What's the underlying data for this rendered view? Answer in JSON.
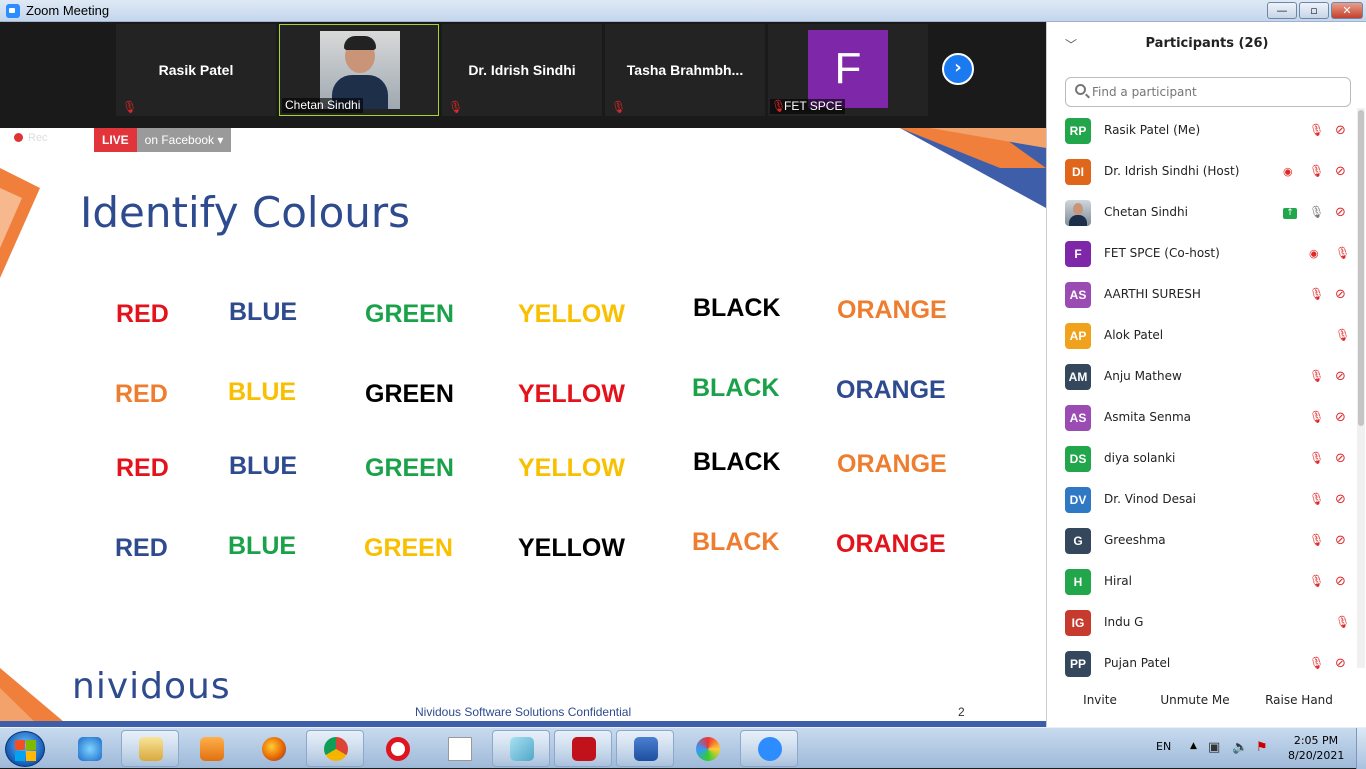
{
  "window": {
    "title": "Zoom Meeting",
    "min": "—",
    "max": "▫",
    "close": "✕"
  },
  "gallery": {
    "tiles": [
      {
        "name": "Rasik Patel"
      },
      {
        "name": "Chetan Sindhi"
      },
      {
        "name": "Dr. Idrish Sindhi"
      },
      {
        "name": "Tasha  Brahmbh..."
      },
      {
        "name": "FET SPCE",
        "avatar_letter": "F"
      }
    ],
    "next": "›"
  },
  "recording": {
    "label": "Rec",
    "live": "LIVE",
    "platform": "on Facebook",
    "dropdown": "▾"
  },
  "slide": {
    "title": "Identify Colours",
    "rows": [
      [
        {
          "t": "RED",
          "c": "#e4121b"
        },
        {
          "t": "BLUE",
          "c": "#2f4b8f"
        },
        {
          "t": "GREEN",
          "c": "#1aa24a"
        },
        {
          "t": "YELLOW",
          "c": "#f8c000"
        },
        {
          "t": "BLACK",
          "c": "#000000"
        },
        {
          "t": "ORANGE",
          "c": "#ee7d2f"
        }
      ],
      [
        {
          "t": "RED",
          "c": "#ee7d2f"
        },
        {
          "t": "BLUE",
          "c": "#f8c000"
        },
        {
          "t": "GREEN",
          "c": "#000000"
        },
        {
          "t": "YELLOW",
          "c": "#e4121b"
        },
        {
          "t": "BLACK",
          "c": "#1aa24a"
        },
        {
          "t": "ORANGE",
          "c": "#2f4b8f"
        }
      ],
      [
        {
          "t": "RED",
          "c": "#e4121b"
        },
        {
          "t": "BLUE",
          "c": "#2f4b8f"
        },
        {
          "t": "GREEN",
          "c": "#1aa24a"
        },
        {
          "t": "YELLOW",
          "c": "#f8c000"
        },
        {
          "t": "BLACK",
          "c": "#000000"
        },
        {
          "t": "ORANGE",
          "c": "#ee7d2f"
        }
      ],
      [
        {
          "t": "RED",
          "c": "#2f4b8f"
        },
        {
          "t": "BLUE",
          "c": "#1aa24a"
        },
        {
          "t": "GREEN",
          "c": "#f8c000"
        },
        {
          "t": "YELLOW",
          "c": "#000000"
        },
        {
          "t": "BLACK",
          "c": "#ee7d2f"
        },
        {
          "t": "ORANGE",
          "c": "#e4121b"
        }
      ]
    ],
    "logo": "nividous",
    "footer": "Nividous Software Solutions Confidential",
    "page": "2"
  },
  "participants": {
    "header": "Participants (26)",
    "search_placeholder": "Find a participant",
    "list": [
      {
        "initials": "RP",
        "color": "#22a64b",
        "name": "Rasik Patel (Me)",
        "icons": [
          "mic-muted",
          "video-off"
        ]
      },
      {
        "initials": "DI",
        "color": "#e0661c",
        "name": "Dr. Idrish Sindhi (Host)",
        "icons": [
          "recording",
          "mic-muted",
          "video-off"
        ]
      },
      {
        "initials": "",
        "color": "#8a9aa8",
        "name": "Chetan Sindhi",
        "icons": [
          "sharing",
          "mic-on",
          "video-off"
        ],
        "photo": true
      },
      {
        "initials": "F",
        "color": "#7e27a8",
        "name": "FET SPCE (Co-host)",
        "icons": [
          "recording",
          "mic-muted"
        ]
      },
      {
        "initials": "AS",
        "color": "#9b4cb3",
        "name": "AARTHI SURESH",
        "icons": [
          "mic-muted",
          "video-off"
        ]
      },
      {
        "initials": "AP",
        "color": "#f0a21c",
        "name": "Alok Patel",
        "icons": [
          "mic-muted"
        ]
      },
      {
        "initials": "AM",
        "color": "#35475c",
        "name": "Anju Mathew",
        "icons": [
          "mic-muted",
          "video-off"
        ]
      },
      {
        "initials": "AS",
        "color": "#9b4cb3",
        "name": "Asmita Senma",
        "icons": [
          "mic-muted",
          "video-off"
        ]
      },
      {
        "initials": "DS",
        "color": "#22a64b",
        "name": "diya solanki",
        "icons": [
          "mic-muted",
          "video-off"
        ]
      },
      {
        "initials": "DV",
        "color": "#2f78c3",
        "name": "Dr. Vinod Desai",
        "icons": [
          "mic-muted",
          "video-off"
        ]
      },
      {
        "initials": "G",
        "color": "#35475c",
        "name": "Greeshma",
        "icons": [
          "mic-muted",
          "video-off"
        ]
      },
      {
        "initials": "H",
        "color": "#22a64b",
        "name": "Hiral",
        "icons": [
          "mic-muted",
          "video-off"
        ]
      },
      {
        "initials": "IG",
        "color": "#c73b2e",
        "name": "Indu G",
        "icons": [
          "mic-muted"
        ]
      },
      {
        "initials": "PP",
        "color": "#35475c",
        "name": "Pujan Patel",
        "icons": [
          "mic-muted",
          "video-off"
        ]
      }
    ],
    "buttons": {
      "invite": "Invite",
      "unmute": "Unmute Me",
      "raise": "Raise Hand"
    }
  },
  "taskbar": {
    "lang": "EN",
    "time": "2:05 PM",
    "date": "8/20/2021"
  }
}
